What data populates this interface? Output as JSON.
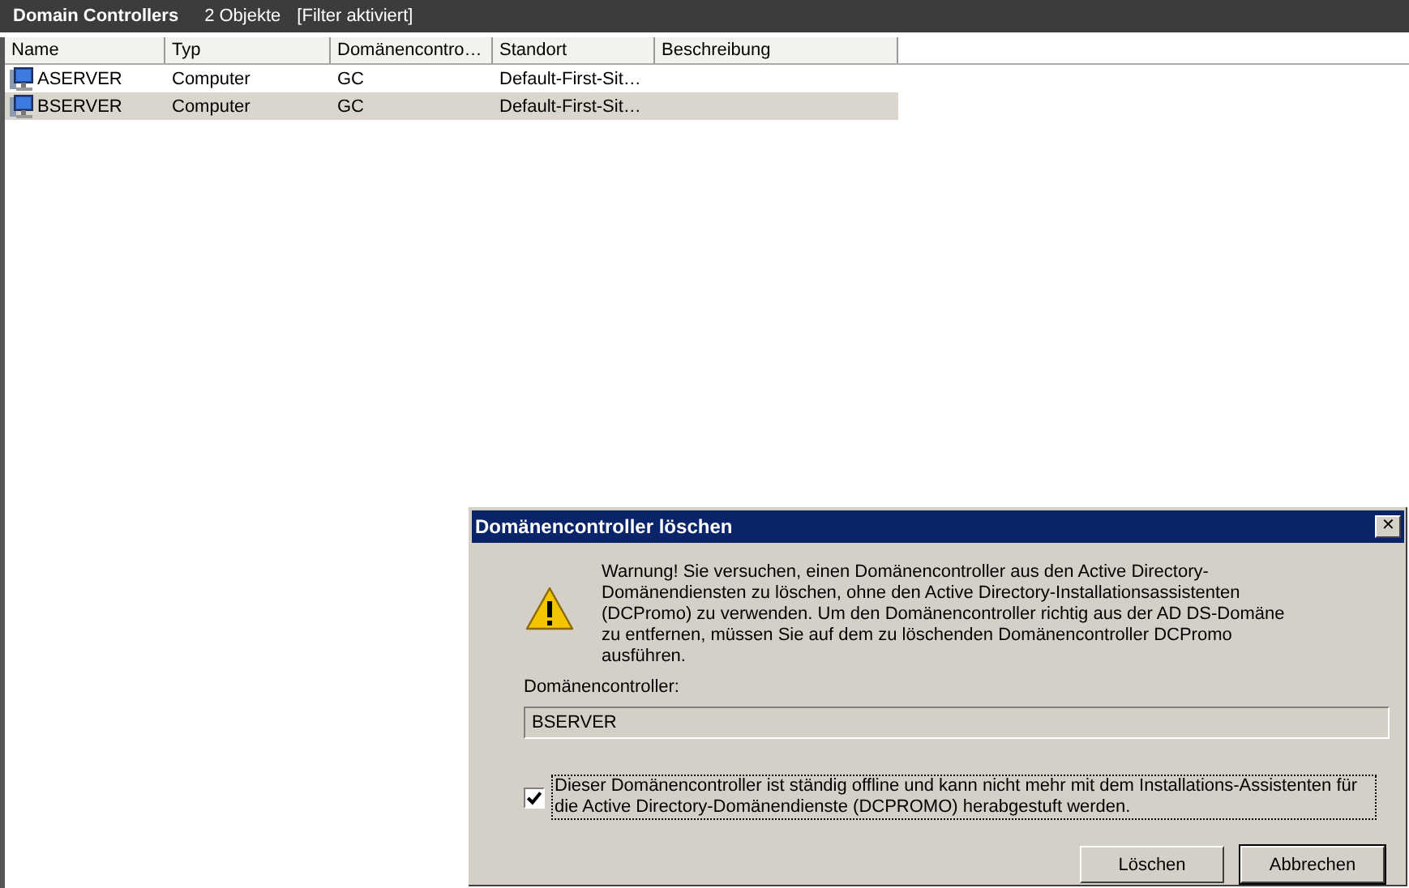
{
  "header": {
    "title": "Domain Controllers",
    "count": "2 Objekte",
    "filter": "[Filter aktiviert]"
  },
  "table": {
    "columns": [
      "Name",
      "Typ",
      "Domänencontro…",
      "Standort",
      "Beschreibung"
    ],
    "rows": [
      {
        "cells": [
          "ASERVER",
          "Computer",
          "GC",
          "Default-First-Sit…"
        ],
        "selected": false
      },
      {
        "cells": [
          "BSERVER",
          "Computer",
          "GC",
          "Default-First-Sit…"
        ],
        "selected": true
      }
    ]
  },
  "dialog": {
    "title": "Domänencontroller löschen",
    "close": "✕",
    "warning": "Warnung! Sie versuchen, einen Domänencontroller aus den Active Directory-Domänendiensten zu löschen, ohne den Active Directory-Installationsassistenten (DCPromo) zu verwenden. Um den Domänencontroller richtig aus der AD DS-Domäne zu entfernen, müssen Sie auf dem zu löschenden Domänencontroller DCPromo ausführen.",
    "field_label": "Domänencontroller:",
    "field_value": "BSERVER",
    "checkbox": {
      "label": "Dieser Domänencontroller ist ständig offline und kann nicht mehr mit dem Installations-Assistenten für die Active Directory-Domänendienste (DCPROMO) herabgestuft werden.",
      "checked": true
    },
    "buttons": [
      "Löschen",
      "Abbrechen"
    ]
  }
}
